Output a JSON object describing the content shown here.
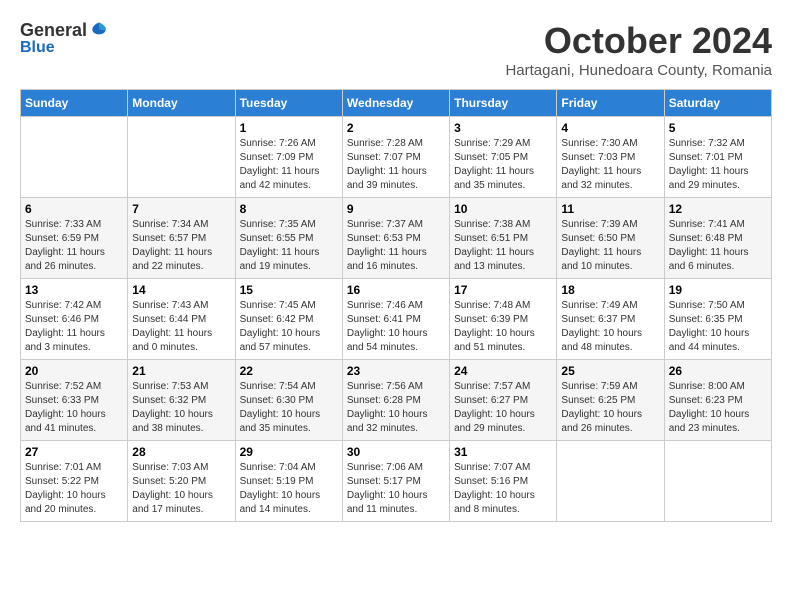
{
  "logo": {
    "general": "General",
    "blue": "Blue"
  },
  "title": "October 2024",
  "location": "Hartagani, Hunedoara County, Romania",
  "weekdays": [
    "Sunday",
    "Monday",
    "Tuesday",
    "Wednesday",
    "Thursday",
    "Friday",
    "Saturday"
  ],
  "weeks": [
    [
      {
        "day": "",
        "info": ""
      },
      {
        "day": "",
        "info": ""
      },
      {
        "day": "1",
        "info": "Sunrise: 7:26 AM\nSunset: 7:09 PM\nDaylight: 11 hours and 42 minutes."
      },
      {
        "day": "2",
        "info": "Sunrise: 7:28 AM\nSunset: 7:07 PM\nDaylight: 11 hours and 39 minutes."
      },
      {
        "day": "3",
        "info": "Sunrise: 7:29 AM\nSunset: 7:05 PM\nDaylight: 11 hours and 35 minutes."
      },
      {
        "day": "4",
        "info": "Sunrise: 7:30 AM\nSunset: 7:03 PM\nDaylight: 11 hours and 32 minutes."
      },
      {
        "day": "5",
        "info": "Sunrise: 7:32 AM\nSunset: 7:01 PM\nDaylight: 11 hours and 29 minutes."
      }
    ],
    [
      {
        "day": "6",
        "info": "Sunrise: 7:33 AM\nSunset: 6:59 PM\nDaylight: 11 hours and 26 minutes."
      },
      {
        "day": "7",
        "info": "Sunrise: 7:34 AM\nSunset: 6:57 PM\nDaylight: 11 hours and 22 minutes."
      },
      {
        "day": "8",
        "info": "Sunrise: 7:35 AM\nSunset: 6:55 PM\nDaylight: 11 hours and 19 minutes."
      },
      {
        "day": "9",
        "info": "Sunrise: 7:37 AM\nSunset: 6:53 PM\nDaylight: 11 hours and 16 minutes."
      },
      {
        "day": "10",
        "info": "Sunrise: 7:38 AM\nSunset: 6:51 PM\nDaylight: 11 hours and 13 minutes."
      },
      {
        "day": "11",
        "info": "Sunrise: 7:39 AM\nSunset: 6:50 PM\nDaylight: 11 hours and 10 minutes."
      },
      {
        "day": "12",
        "info": "Sunrise: 7:41 AM\nSunset: 6:48 PM\nDaylight: 11 hours and 6 minutes."
      }
    ],
    [
      {
        "day": "13",
        "info": "Sunrise: 7:42 AM\nSunset: 6:46 PM\nDaylight: 11 hours and 3 minutes."
      },
      {
        "day": "14",
        "info": "Sunrise: 7:43 AM\nSunset: 6:44 PM\nDaylight: 11 hours and 0 minutes."
      },
      {
        "day": "15",
        "info": "Sunrise: 7:45 AM\nSunset: 6:42 PM\nDaylight: 10 hours and 57 minutes."
      },
      {
        "day": "16",
        "info": "Sunrise: 7:46 AM\nSunset: 6:41 PM\nDaylight: 10 hours and 54 minutes."
      },
      {
        "day": "17",
        "info": "Sunrise: 7:48 AM\nSunset: 6:39 PM\nDaylight: 10 hours and 51 minutes."
      },
      {
        "day": "18",
        "info": "Sunrise: 7:49 AM\nSunset: 6:37 PM\nDaylight: 10 hours and 48 minutes."
      },
      {
        "day": "19",
        "info": "Sunrise: 7:50 AM\nSunset: 6:35 PM\nDaylight: 10 hours and 44 minutes."
      }
    ],
    [
      {
        "day": "20",
        "info": "Sunrise: 7:52 AM\nSunset: 6:33 PM\nDaylight: 10 hours and 41 minutes."
      },
      {
        "day": "21",
        "info": "Sunrise: 7:53 AM\nSunset: 6:32 PM\nDaylight: 10 hours and 38 minutes."
      },
      {
        "day": "22",
        "info": "Sunrise: 7:54 AM\nSunset: 6:30 PM\nDaylight: 10 hours and 35 minutes."
      },
      {
        "day": "23",
        "info": "Sunrise: 7:56 AM\nSunset: 6:28 PM\nDaylight: 10 hours and 32 minutes."
      },
      {
        "day": "24",
        "info": "Sunrise: 7:57 AM\nSunset: 6:27 PM\nDaylight: 10 hours and 29 minutes."
      },
      {
        "day": "25",
        "info": "Sunrise: 7:59 AM\nSunset: 6:25 PM\nDaylight: 10 hours and 26 minutes."
      },
      {
        "day": "26",
        "info": "Sunrise: 8:00 AM\nSunset: 6:23 PM\nDaylight: 10 hours and 23 minutes."
      }
    ],
    [
      {
        "day": "27",
        "info": "Sunrise: 7:01 AM\nSunset: 5:22 PM\nDaylight: 10 hours and 20 minutes."
      },
      {
        "day": "28",
        "info": "Sunrise: 7:03 AM\nSunset: 5:20 PM\nDaylight: 10 hours and 17 minutes."
      },
      {
        "day": "29",
        "info": "Sunrise: 7:04 AM\nSunset: 5:19 PM\nDaylight: 10 hours and 14 minutes."
      },
      {
        "day": "30",
        "info": "Sunrise: 7:06 AM\nSunset: 5:17 PM\nDaylight: 10 hours and 11 minutes."
      },
      {
        "day": "31",
        "info": "Sunrise: 7:07 AM\nSunset: 5:16 PM\nDaylight: 10 hours and 8 minutes."
      },
      {
        "day": "",
        "info": ""
      },
      {
        "day": "",
        "info": ""
      }
    ]
  ]
}
